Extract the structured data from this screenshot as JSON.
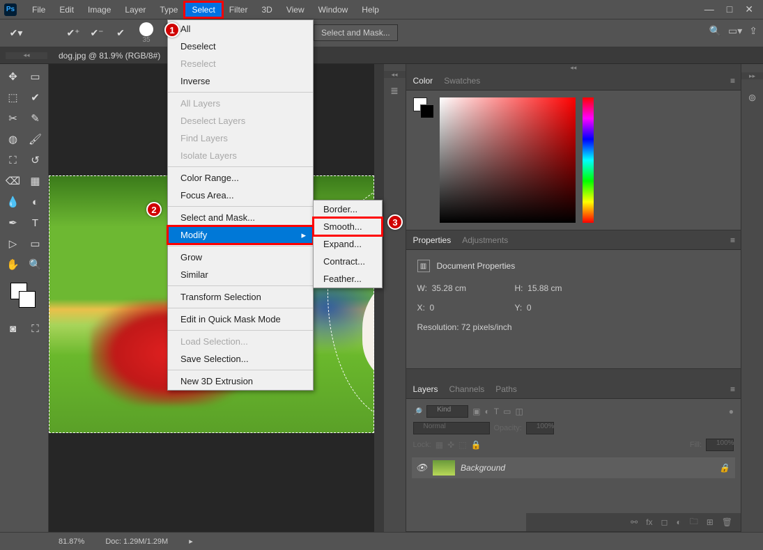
{
  "menu": {
    "items": [
      "File",
      "Edit",
      "Image",
      "Layer",
      "Type",
      "Select",
      "Filter",
      "3D",
      "View",
      "Window",
      "Help"
    ],
    "highlighted": "Select"
  },
  "window": {
    "min": "—",
    "max": "□",
    "close": "✕"
  },
  "options": {
    "brush_size": "35",
    "select_mask": "Select and Mask...",
    "search": "🔍",
    "arrange": "▭▾",
    "share": "⇪"
  },
  "doc_tab": "dog.jpg @ 81.9% (RGB/8#)",
  "dropdown": {
    "g1": [
      "All",
      "Deselect",
      "Reselect",
      "Inverse"
    ],
    "g2": [
      "All Layers",
      "Deselect Layers",
      "Find Layers",
      "Isolate Layers"
    ],
    "g3": [
      "Color Range...",
      "Focus Area..."
    ],
    "g4": [
      "Select and Mask...",
      "Modify"
    ],
    "g5": [
      "Grow",
      "Similar"
    ],
    "g6": [
      "Transform Selection"
    ],
    "g7": [
      "Edit in Quick Mask Mode"
    ],
    "g8": [
      "Load Selection...",
      "Save Selection..."
    ],
    "g9": [
      "New 3D Extrusion"
    ]
  },
  "submenu": [
    "Border...",
    "Smooth...",
    "Expand...",
    "Contract...",
    "Feather..."
  ],
  "badges": {
    "b1": "1",
    "b2": "2",
    "b3": "3"
  },
  "panels": {
    "color_tab": "Color",
    "swatches_tab": "Swatches",
    "props_tab": "Properties",
    "adjust_tab": "Adjustments",
    "props_title": "Document Properties",
    "w_label": "W:",
    "w_val": "35.28 cm",
    "h_label": "H:",
    "h_val": "15.88 cm",
    "x_label": "X:",
    "x_val": "0",
    "y_label": "Y:",
    "y_val": "0",
    "res": "Resolution: 72 pixels/inch",
    "layers_tab": "Layers",
    "channels_tab": "Channels",
    "paths_tab": "Paths",
    "kind": "Kind",
    "normal": "Normal",
    "opacity_lbl": "Opacity:",
    "opacity_val": "100%",
    "lock_lbl": "Lock:",
    "fill_lbl": "Fill:",
    "fill_val": "100%",
    "layer_name": "Background"
  },
  "status": {
    "zoom": "81.87%",
    "doc": "Doc: 1.29M/1.29M"
  },
  "tool_icons": [
    "✥",
    "▭",
    "⬚",
    "✂",
    "✎",
    "⌖",
    "✏",
    "↺",
    "⬓",
    "⌫",
    "◐",
    "▢",
    "●",
    "▦",
    "✒",
    "T",
    "▷",
    "✧",
    "✋",
    "🔍"
  ],
  "collapser": "◂◂"
}
